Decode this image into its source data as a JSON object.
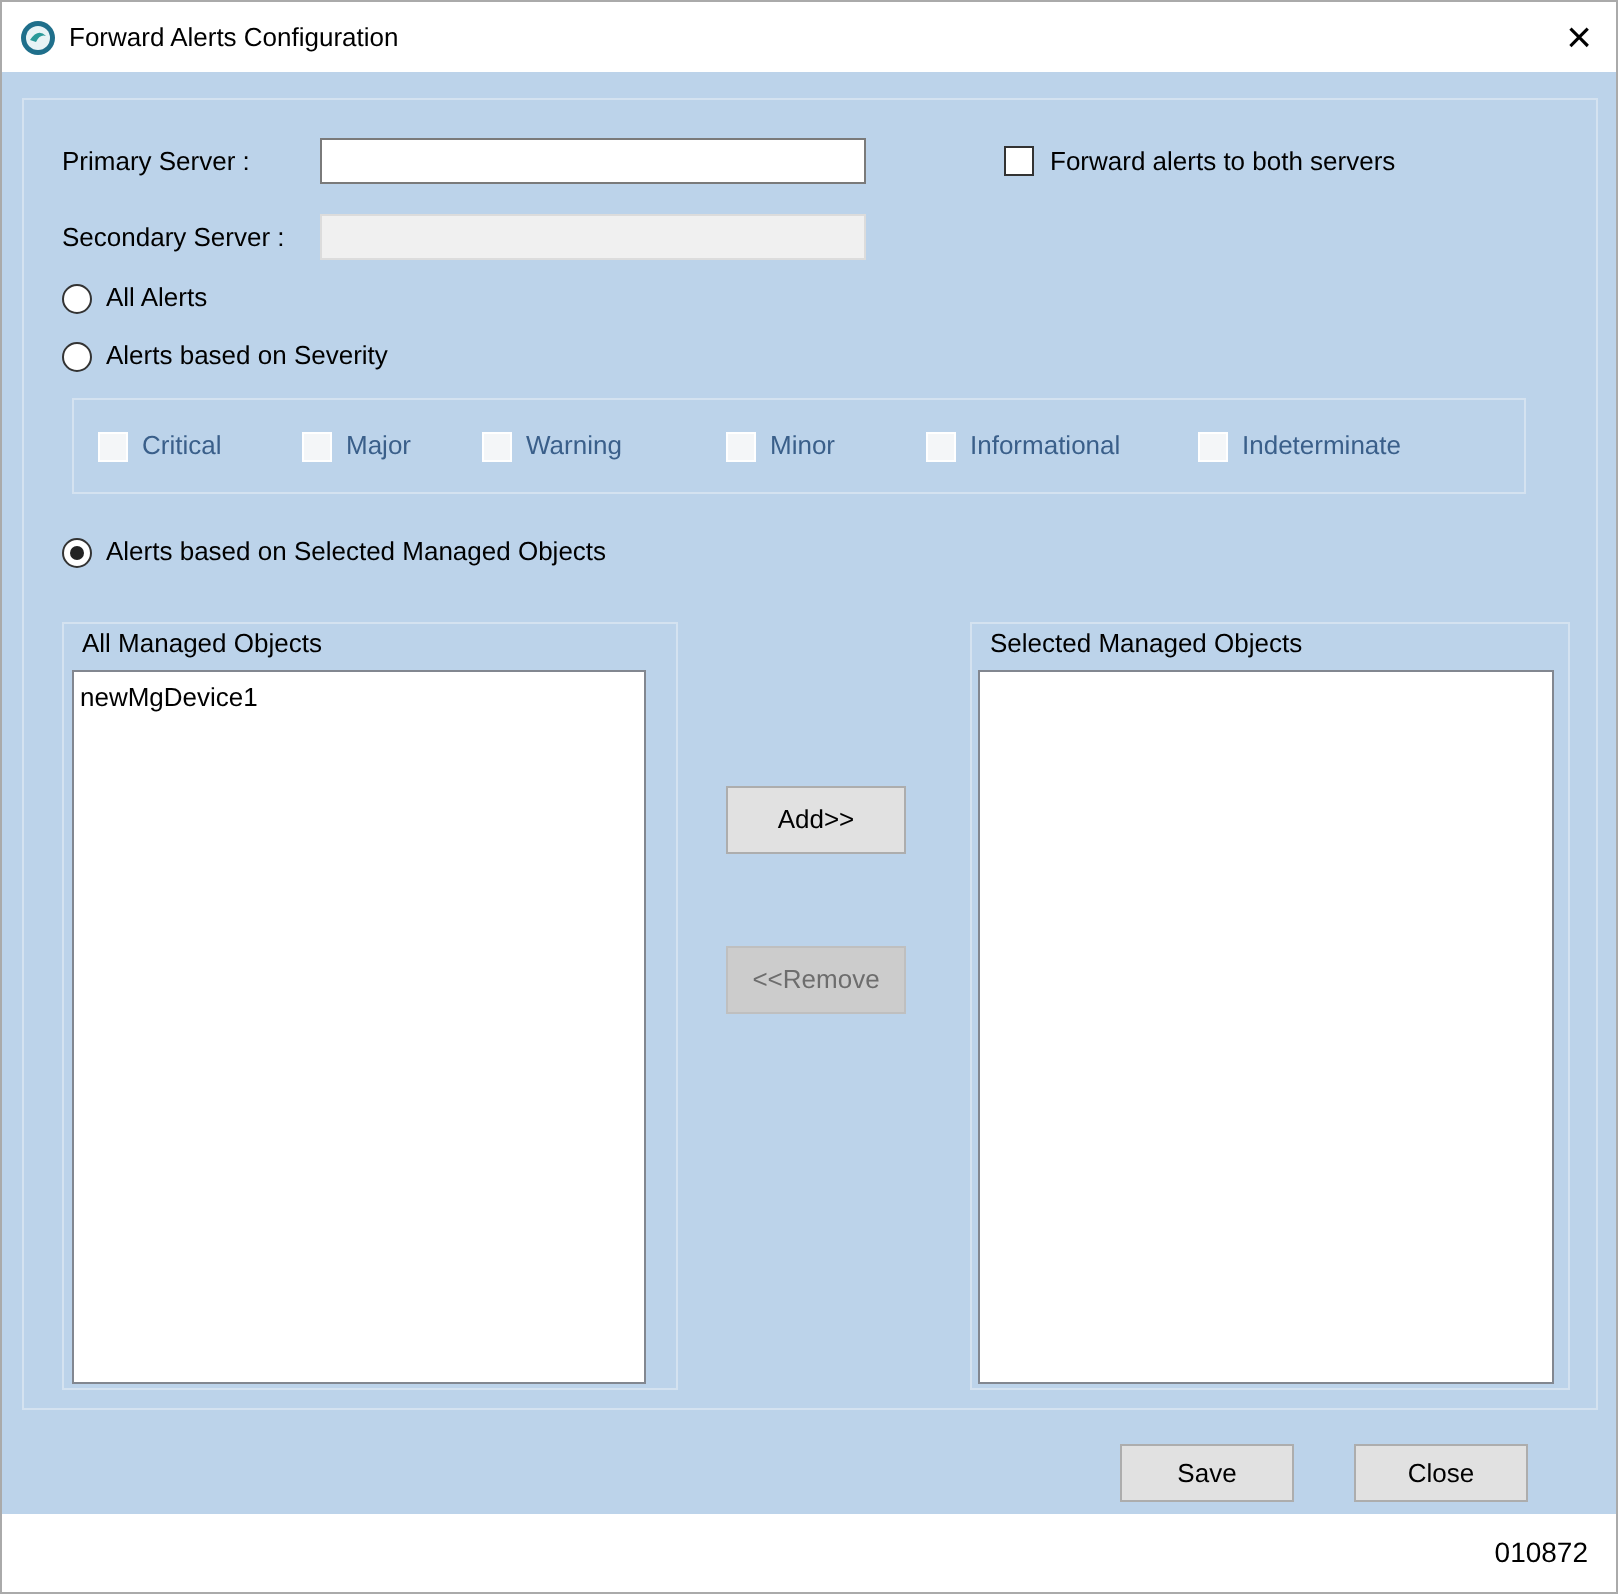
{
  "window": {
    "title": "Forward Alerts Configuration",
    "close": "×"
  },
  "primary_server": {
    "label": "Primary Server :",
    "disabled": false
  },
  "secondary_server": {
    "label": "Secondary Server :",
    "disabled": true
  },
  "forward_both": {
    "label": "Forward alerts to both servers",
    "checked": false
  },
  "radios": [
    {
      "label": "All Alerts",
      "selected": false
    },
    {
      "label": "Alerts based on Severity",
      "selected": false
    },
    {
      "label": "Alerts based on Selected Managed Objects",
      "selected": true
    }
  ],
  "severities": [
    {
      "label": "Critical",
      "checked": false,
      "disabled": true
    },
    {
      "label": "Major",
      "checked": false,
      "disabled": true
    },
    {
      "label": "Warning",
      "checked": false,
      "disabled": true
    },
    {
      "label": "Minor",
      "checked": false,
      "disabled": true
    },
    {
      "label": "Informational",
      "checked": false,
      "disabled": true
    },
    {
      "label": "Indeterminate",
      "checked": false,
      "disabled": true
    }
  ],
  "all_objects": {
    "title": "All Managed Objects",
    "items": [
      "newMgDevice1"
    ]
  },
  "selected_objects": {
    "title": "Selected Managed Objects"
  },
  "add_button": {
    "label": "Add>>",
    "disabled": false
  },
  "remove_button": {
    "label": "<<Remove",
    "disabled": true
  },
  "footer_buttons": [
    {
      "label": "Save"
    },
    {
      "label": "Close"
    }
  ],
  "figure_number": "010872"
}
